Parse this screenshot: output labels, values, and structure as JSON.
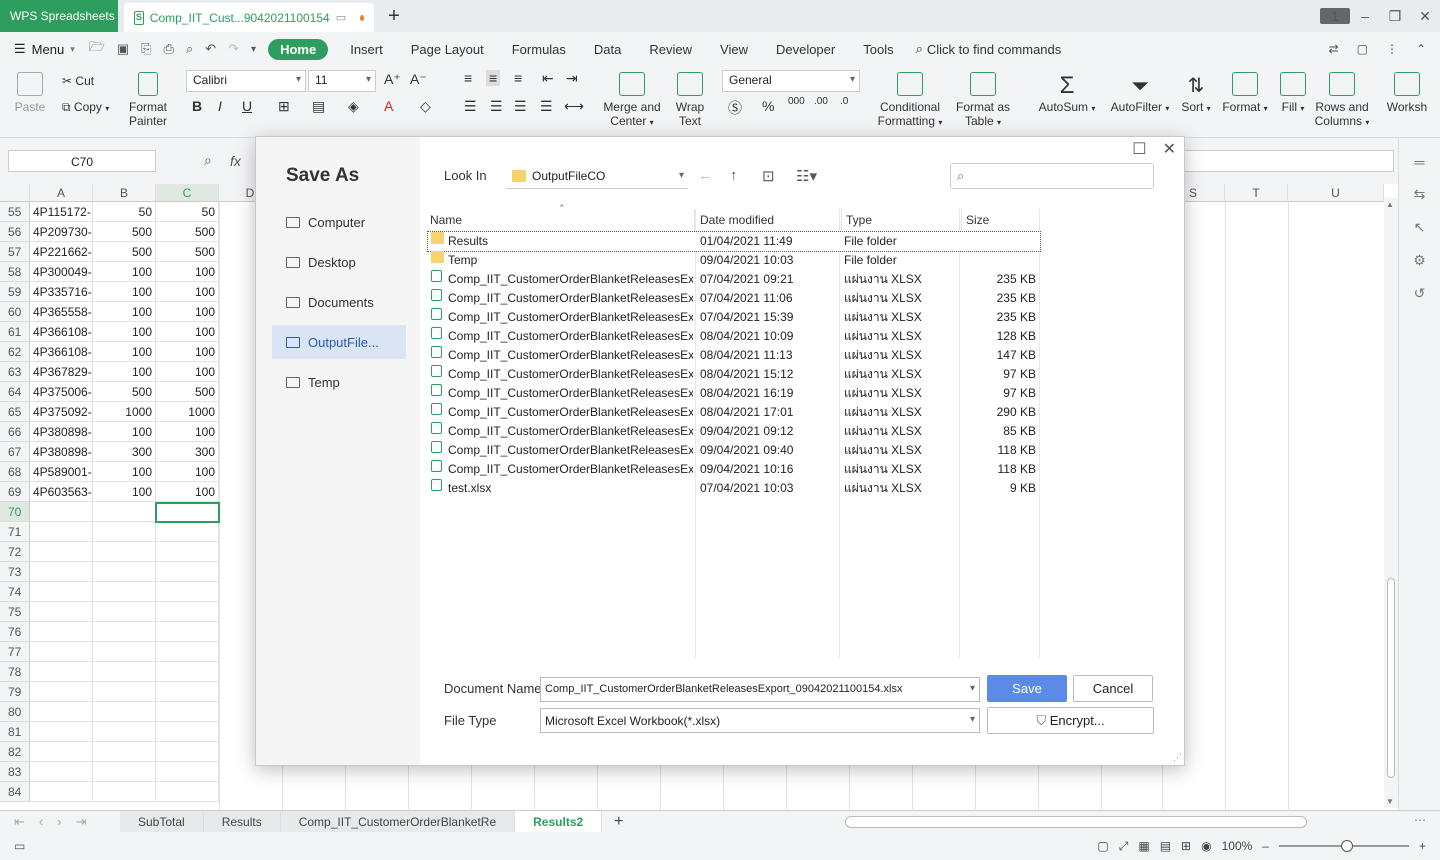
{
  "titlebar": {
    "app_name": "WPS Spreadsheets",
    "doc_tab": "Comp_IIT_Cust...9042021100154",
    "window_count": "1"
  },
  "menubar": {
    "menu_label": "Menu",
    "tabs": [
      "Home",
      "Insert",
      "Page Layout",
      "Formulas",
      "Data",
      "Review",
      "View",
      "Developer",
      "Tools"
    ],
    "find_commands": "Click to find commands"
  },
  "ribbon": {
    "paste": "Paste",
    "cut": "Cut",
    "copy": "Copy",
    "format_painter_1": "Format",
    "format_painter_2": "Painter",
    "font_name": "Calibri",
    "font_size": "11",
    "merge_center_1": "Merge and",
    "merge_center_2": "Center",
    "wrap_text_1": "Wrap",
    "wrap_text_2": "Text",
    "number_format": "General",
    "cond_fmt_1": "Conditional",
    "cond_fmt_2": "Formatting",
    "fmt_table_1": "Format as",
    "fmt_table_2": "Table",
    "autosum": "AutoSum",
    "autofilter": "AutoFilter",
    "sort": "Sort",
    "format": "Format",
    "fill": "Fill",
    "rows_cols_1": "Rows and",
    "rows_cols_2": "Columns",
    "worksheet": "Worksh"
  },
  "formula_bar": {
    "name_box": "C70",
    "fx": "fx"
  },
  "grid": {
    "columns_left": [
      "A",
      "B",
      "C",
      "D"
    ],
    "columns_right": [
      "S",
      "T",
      "U"
    ],
    "rows": [
      {
        "n": "55",
        "a": "4P115172-",
        "b": "50",
        "c": "50"
      },
      {
        "n": "56",
        "a": "4P209730-",
        "b": "500",
        "c": "500"
      },
      {
        "n": "57",
        "a": "4P221662-",
        "b": "500",
        "c": "500"
      },
      {
        "n": "58",
        "a": "4P300049-",
        "b": "100",
        "c": "100"
      },
      {
        "n": "59",
        "a": "4P335716-",
        "b": "100",
        "c": "100"
      },
      {
        "n": "60",
        "a": "4P365558-",
        "b": "100",
        "c": "100"
      },
      {
        "n": "61",
        "a": "4P366108-",
        "b": "100",
        "c": "100"
      },
      {
        "n": "62",
        "a": "4P366108-",
        "b": "100",
        "c": "100"
      },
      {
        "n": "63",
        "a": "4P367829-",
        "b": "100",
        "c": "100"
      },
      {
        "n": "64",
        "a": "4P375006-",
        "b": "500",
        "c": "500"
      },
      {
        "n": "65",
        "a": "4P375092-",
        "b": "1000",
        "c": "1000"
      },
      {
        "n": "66",
        "a": "4P380898-",
        "b": "100",
        "c": "100"
      },
      {
        "n": "67",
        "a": "4P380898-",
        "b": "300",
        "c": "300"
      },
      {
        "n": "68",
        "a": "4P589001-",
        "b": "100",
        "c": "100"
      },
      {
        "n": "69",
        "a": "4P603563-",
        "b": "100",
        "c": "100"
      },
      {
        "n": "70",
        "a": "",
        "b": "",
        "c": ""
      },
      {
        "n": "71",
        "a": "",
        "b": "",
        "c": ""
      },
      {
        "n": "72",
        "a": "",
        "b": "",
        "c": ""
      },
      {
        "n": "73",
        "a": "",
        "b": "",
        "c": ""
      },
      {
        "n": "74",
        "a": "",
        "b": "",
        "c": ""
      },
      {
        "n": "75",
        "a": "",
        "b": "",
        "c": ""
      },
      {
        "n": "76",
        "a": "",
        "b": "",
        "c": ""
      },
      {
        "n": "77",
        "a": "",
        "b": "",
        "c": ""
      },
      {
        "n": "78",
        "a": "",
        "b": "",
        "c": ""
      },
      {
        "n": "79",
        "a": "",
        "b": "",
        "c": ""
      },
      {
        "n": "80",
        "a": "",
        "b": "",
        "c": ""
      },
      {
        "n": "81",
        "a": "",
        "b": "",
        "c": ""
      },
      {
        "n": "82",
        "a": "",
        "b": "",
        "c": ""
      },
      {
        "n": "83",
        "a": "",
        "b": "",
        "c": ""
      },
      {
        "n": "84",
        "a": "",
        "b": "",
        "c": ""
      }
    ]
  },
  "sheets": {
    "tabs": [
      "SubTotal",
      "Results",
      "Comp_IIT_CustomerOrderBlanketRe",
      "Results2"
    ],
    "active": "Results2"
  },
  "statusbar": {
    "zoom": "100%"
  },
  "dialog": {
    "title": "Save As",
    "sidebar": [
      "Computer",
      "Desktop",
      "Documents",
      "OutputFile...",
      "Temp"
    ],
    "sidebar_active": "OutputFile...",
    "look_in_label": "Look In",
    "look_in_value": "OutputFileCO",
    "headers": {
      "name": "Name",
      "date": "Date modified",
      "type": "Type",
      "size": "Size"
    },
    "files": [
      {
        "name": "Results",
        "date": "01/04/2021 11:49",
        "type": "File folder",
        "size": "",
        "kind": "folder"
      },
      {
        "name": "Temp",
        "date": "09/04/2021 10:03",
        "type": "File folder",
        "size": "",
        "kind": "folder"
      },
      {
        "name": "Comp_IIT_CustomerOrderBlanketReleasesEx...",
        "date": "07/04/2021 09:21",
        "type": "แผ่นงาน XLSX",
        "size": "235 KB",
        "kind": "xlsx"
      },
      {
        "name": "Comp_IIT_CustomerOrderBlanketReleasesEx...",
        "date": "07/04/2021 11:06",
        "type": "แผ่นงาน XLSX",
        "size": "235 KB",
        "kind": "xlsx"
      },
      {
        "name": "Comp_IIT_CustomerOrderBlanketReleasesEx...",
        "date": "07/04/2021 15:39",
        "type": "แผ่นงาน XLSX",
        "size": "235 KB",
        "kind": "xlsx"
      },
      {
        "name": "Comp_IIT_CustomerOrderBlanketReleasesEx...",
        "date": "08/04/2021 10:09",
        "type": "แผ่นงาน XLSX",
        "size": "128 KB",
        "kind": "xlsx"
      },
      {
        "name": "Comp_IIT_CustomerOrderBlanketReleasesEx...",
        "date": "08/04/2021 11:13",
        "type": "แผ่นงาน XLSX",
        "size": "147 KB",
        "kind": "xlsx"
      },
      {
        "name": "Comp_IIT_CustomerOrderBlanketReleasesEx...",
        "date": "08/04/2021 15:12",
        "type": "แผ่นงาน XLSX",
        "size": "97 KB",
        "kind": "xlsx"
      },
      {
        "name": "Comp_IIT_CustomerOrderBlanketReleasesEx...",
        "date": "08/04/2021 16:19",
        "type": "แผ่นงาน XLSX",
        "size": "97 KB",
        "kind": "xlsx"
      },
      {
        "name": "Comp_IIT_CustomerOrderBlanketReleasesEx...",
        "date": "08/04/2021 17:01",
        "type": "แผ่นงาน XLSX",
        "size": "290 KB",
        "kind": "xlsx"
      },
      {
        "name": "Comp_IIT_CustomerOrderBlanketReleasesEx...",
        "date": "09/04/2021 09:12",
        "type": "แผ่นงาน XLSX",
        "size": "85 KB",
        "kind": "xlsx"
      },
      {
        "name": "Comp_IIT_CustomerOrderBlanketReleasesEx...",
        "date": "09/04/2021 09:40",
        "type": "แผ่นงาน XLSX",
        "size": "118 KB",
        "kind": "xlsx"
      },
      {
        "name": "Comp_IIT_CustomerOrderBlanketReleasesEx...",
        "date": "09/04/2021 10:16",
        "type": "แผ่นงาน XLSX",
        "size": "118 KB",
        "kind": "xlsx"
      },
      {
        "name": "test.xlsx",
        "date": "07/04/2021 10:03",
        "type": "แผ่นงาน XLSX",
        "size": "9 KB",
        "kind": "xlsx"
      }
    ],
    "document_name_label": "Document Name",
    "document_name_value": "Comp_IIT_CustomerOrderBlanketReleasesExport_09042021100154.xlsx",
    "file_type_label": "File Type",
    "file_type_value": "Microsoft Excel Workbook(*.xlsx)",
    "save_label": "Save",
    "cancel_label": "Cancel",
    "encrypt_label": "Encrypt..."
  },
  "colors": {
    "accent": "#2e9e5e",
    "save_button": "#5b8be6",
    "sidebar_active": "#d9e4f5"
  }
}
